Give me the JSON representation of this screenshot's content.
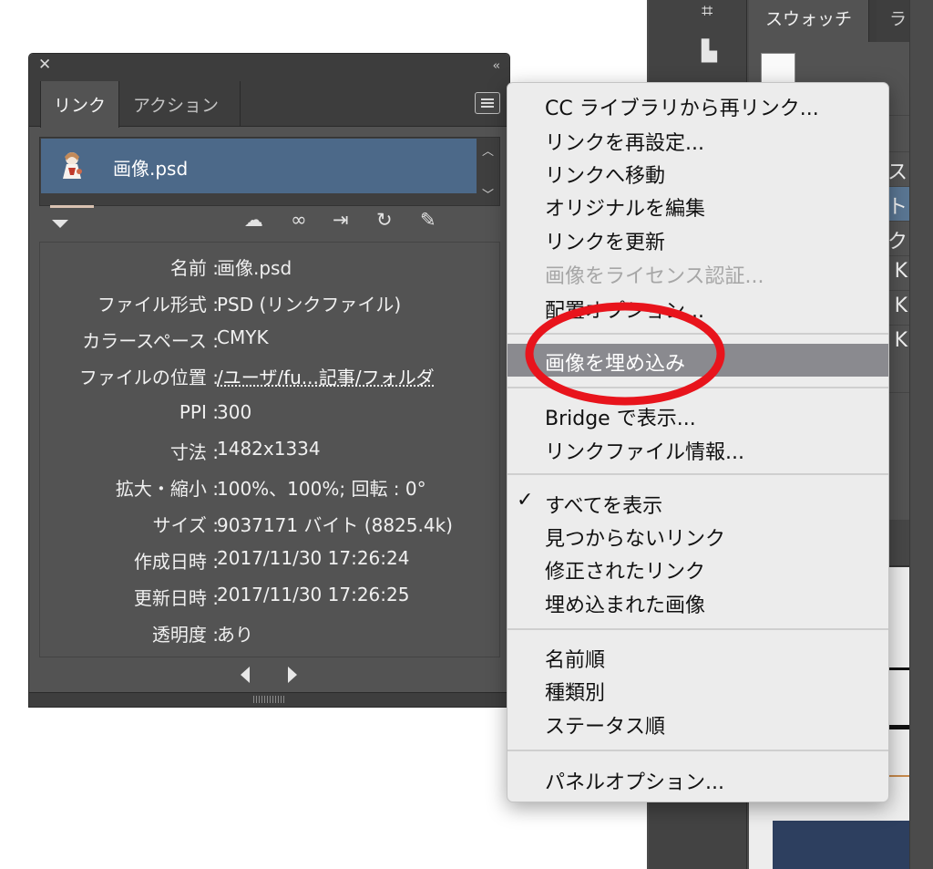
{
  "right_panel": {
    "tabs": [
      "スウォッチ",
      "ラ"
    ],
    "row_fragments": [
      "ス",
      "イト",
      "ック",
      "K",
      "K",
      "K"
    ]
  },
  "links_panel": {
    "close_glyph": "✕",
    "collapse_glyph": "‹‹",
    "tabs": [
      "リンク",
      "アクション"
    ],
    "list": [
      {
        "name": "画像.psd"
      }
    ],
    "info": [
      {
        "label": "名前 :",
        "value": "画像.psd"
      },
      {
        "label": "ファイル形式 :",
        "value": "PSD (リンクファイル)"
      },
      {
        "label": "カラースペース :",
        "value": "CMYK"
      },
      {
        "label": "ファイルの位置 :",
        "value": "/ユーザ/fu...記事/フォルダ"
      },
      {
        "label": "PPI :",
        "value": "300"
      },
      {
        "label": "寸法 :",
        "value": "1482x1334"
      },
      {
        "label": "拡大・縮小 :",
        "value": "100%、100%; 回転 : 0°"
      },
      {
        "label": "サイズ :",
        "value": "9037171 バイト (8825.4k)"
      },
      {
        "label": "作成日時 :",
        "value": "2017/11/30 17:26:24"
      },
      {
        "label": "更新日時 :",
        "value": "2017/11/30 17:26:25"
      },
      {
        "label": "透明度 :",
        "value": "あり"
      }
    ],
    "toolbar_icons": [
      "cc-relink-icon",
      "relink-icon",
      "goto-link-icon",
      "update-link-icon",
      "edit-original-icon"
    ]
  },
  "menu": {
    "items": [
      {
        "label": "CC ライブラリから再リンク...",
        "state": "normal"
      },
      {
        "label": "リンクを再設定...",
        "state": "normal"
      },
      {
        "label": "リンクへ移動",
        "state": "normal"
      },
      {
        "label": "オリジナルを編集",
        "state": "normal"
      },
      {
        "label": "リンクを更新",
        "state": "normal"
      },
      {
        "label": "画像をライセンス認証...",
        "state": "disabled"
      },
      {
        "label": "配置オプション...",
        "state": "normal"
      },
      {
        "label": "画像を埋め込み",
        "state": "highlighted"
      },
      {
        "label": "Bridge で表示...",
        "state": "normal"
      },
      {
        "label": "リンクファイル情報...",
        "state": "normal"
      },
      {
        "label": "すべてを表示",
        "state": "checked"
      },
      {
        "label": "見つからないリンク",
        "state": "normal"
      },
      {
        "label": "修正されたリンク",
        "state": "normal"
      },
      {
        "label": "埋め込まれた画像",
        "state": "normal"
      },
      {
        "label": "名前順",
        "state": "normal"
      },
      {
        "label": "種類別",
        "state": "normal"
      },
      {
        "label": "ステータス順",
        "state": "normal"
      },
      {
        "label": "パネルオプション...",
        "state": "normal"
      }
    ],
    "check_glyph": "✓"
  },
  "annotation": {
    "color": "#e8141c"
  }
}
